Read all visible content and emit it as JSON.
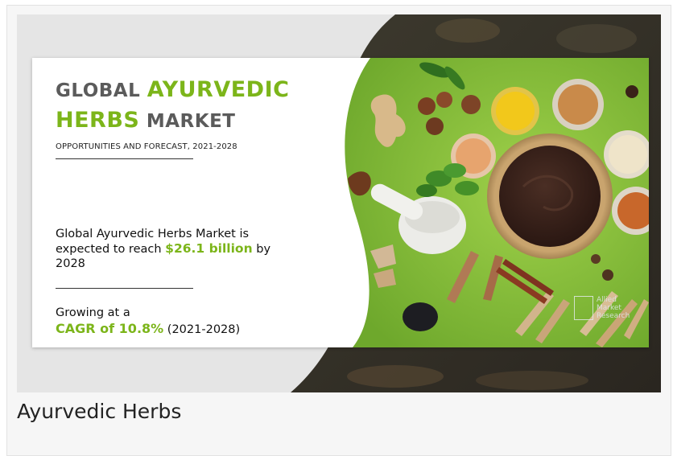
{
  "banner": {
    "title_line1_gray": "GLOBAL ",
    "title_line1_green": "AYURVEDIC",
    "title_line2_green": "HERBS",
    "title_line2_gray": " MARKET",
    "subtitle": "OPPORTUNITIES AND FORECAST, 2021-2028",
    "stat_prefix": "Global Ayurvedic Herbs Market is expected to reach ",
    "stat_value": "$26.1 billion",
    "stat_suffix": " by 2028",
    "growth_prefix": "Growing at a",
    "growth_cagr": "CAGR of 10.8%",
    "growth_period": " (2021-2028)",
    "logo_lines": [
      "Allied",
      "Market",
      "Research"
    ]
  },
  "caption": "Ayurvedic Herbs",
  "colors": {
    "accent_green": "#7cb51a",
    "title_gray": "#5b5b5b",
    "photo_green": "#8cc63f"
  },
  "icons": [
    "allied-market-research-logo"
  ]
}
